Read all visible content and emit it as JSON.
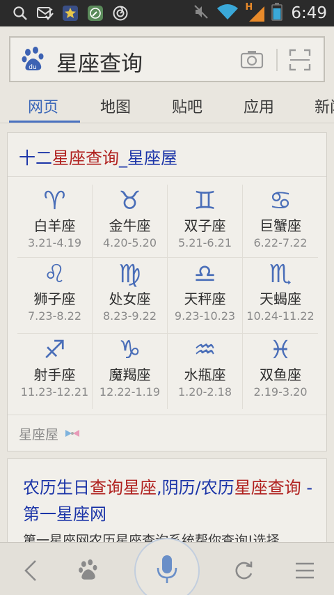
{
  "status_bar": {
    "time": "6:49",
    "network_label": "H",
    "left_icons": [
      "search-icon",
      "mail-check-icon",
      "star-badge-icon",
      "compass-icon",
      "browser-icon"
    ],
    "right_icons": [
      "mute-icon",
      "wifi-icon",
      "signal-icon",
      "battery-icon"
    ]
  },
  "search": {
    "query": "星座查询",
    "logo_icon": "baidu-paw-icon",
    "camera_icon": "camera-icon",
    "scan_icon": "scan-icon"
  },
  "tabs": [
    {
      "label": "网页",
      "active": true
    },
    {
      "label": "地图",
      "active": false
    },
    {
      "label": "贴吧",
      "active": false
    },
    {
      "label": "应用",
      "active": false
    },
    {
      "label": "新闻",
      "active": false
    }
  ],
  "result1": {
    "title_prefix": "十二",
    "title_highlight": "星座查询",
    "title_suffix": "_星座屋",
    "zodiac": [
      {
        "symbol": "♈",
        "name": "白羊座",
        "dates": "3.21-4.19"
      },
      {
        "symbol": "♉",
        "name": "金牛座",
        "dates": "4.20-5.20"
      },
      {
        "symbol": "♊",
        "name": "双子座",
        "dates": "5.21-6.21"
      },
      {
        "symbol": "♋",
        "name": "巨蟹座",
        "dates": "6.22-7.22"
      },
      {
        "symbol": "♌",
        "name": "狮子座",
        "dates": "7.23-8.22"
      },
      {
        "symbol": "♍",
        "name": "处女座",
        "dates": "8.23-9.22"
      },
      {
        "symbol": "♎",
        "name": "天秤座",
        "dates": "9.23-10.23"
      },
      {
        "symbol": "♏",
        "name": "天蝎座",
        "dates": "10.24-11.22"
      },
      {
        "symbol": "♐",
        "name": "射手座",
        "dates": "11.23-12.21"
      },
      {
        "symbol": "♑",
        "name": "魔羯座",
        "dates": "12.22-1.19"
      },
      {
        "symbol": "♒",
        "name": "水瓶座",
        "dates": "1.20-2.18"
      },
      {
        "symbol": "♓",
        "name": "双鱼座",
        "dates": "2.19-3.20"
      }
    ],
    "source": "星座屋",
    "source_icon": "bow-tie-icon"
  },
  "result2": {
    "title_parts": [
      {
        "text": "农历生日",
        "highlight": false
      },
      {
        "text": "查询",
        "highlight": true
      },
      {
        "text": "星座",
        "highlight": true
      },
      {
        "text": ",阴历/农历",
        "highlight": false
      },
      {
        "text": "星座",
        "highlight": true
      },
      {
        "text": "查询",
        "highlight": true
      },
      {
        "text": " - 第一星座网",
        "highlight": false
      }
    ],
    "snippet": "第一星座网农历星座查询系统帮你查询!选择"
  },
  "bottom_bar": {
    "icons": [
      "back-icon",
      "baidu-paw-icon",
      "microphone-icon",
      "refresh-icon",
      "menu-icon"
    ]
  },
  "colors": {
    "accent": "#3b67b8",
    "link": "#1c35a8",
    "highlight": "#b0211f",
    "zodiac": "#4a6eb8"
  }
}
